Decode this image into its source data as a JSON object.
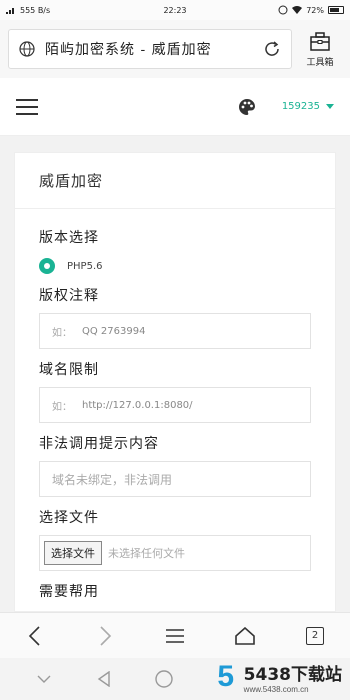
{
  "status_bar": {
    "signal": "555 B/s",
    "time": "22:23",
    "battery": "72%"
  },
  "browser": {
    "page_title": "陌屿加密系统 - 威盾加密",
    "toolbox_label": "工具箱"
  },
  "header": {
    "user": "159235"
  },
  "card": {
    "title": "威盾加密",
    "version_label": "版本选择",
    "version_option": "PHP5.6",
    "comment_label": "版权注释",
    "comment_placeholder_prefix": "如：",
    "comment_placeholder": "QQ 2763994",
    "domain_label": "域名限制",
    "domain_placeholder_prefix": "如：",
    "domain_placeholder": "http://127.0.0.1:8080/",
    "illegal_label": "非法调用提示内容",
    "illegal_placeholder": "域名未绑定，非法调用",
    "file_label": "选择文件",
    "file_button": "选择文件",
    "file_status": "未选择任何文件",
    "next_label": "需要帮用"
  },
  "bottom_nav": {
    "tab_count": "2"
  },
  "watermark": {
    "name": "5438下载站",
    "url": "www.5438.com.cn",
    "logo": "5"
  },
  "colors": {
    "accent": "#1ab394",
    "watermark_blue": "#1e9ad6"
  }
}
